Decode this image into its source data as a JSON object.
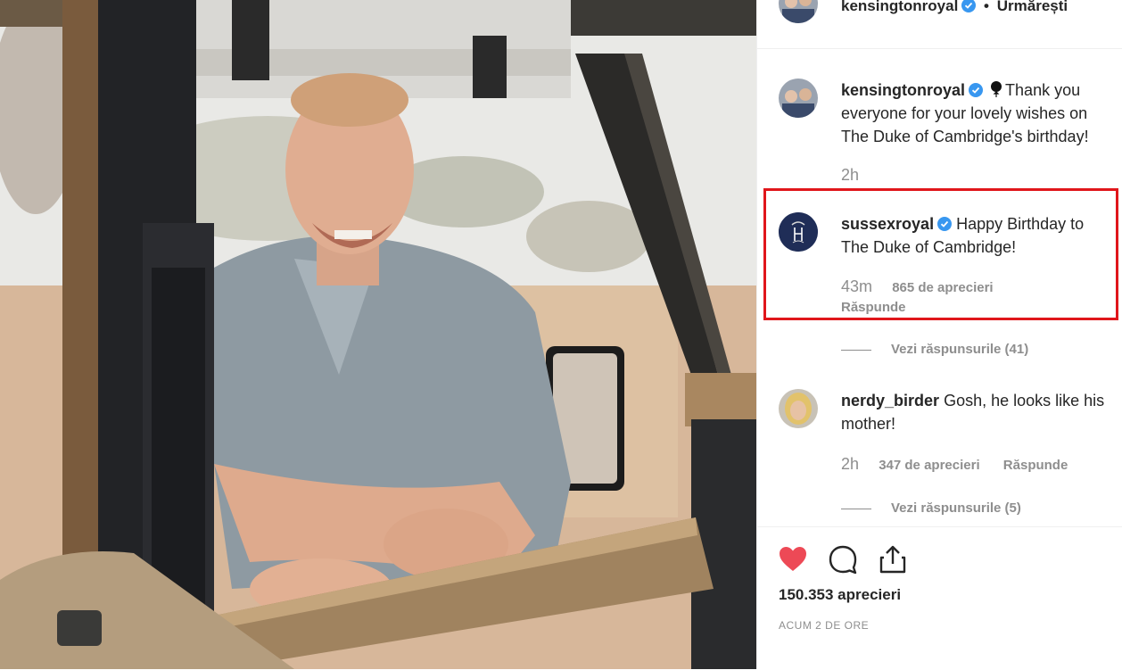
{
  "header": {
    "username": "kensingtonroyal",
    "separator": "•",
    "follow_state": "Urmărești"
  },
  "comments": [
    {
      "username": "kensingtonroyal",
      "text": "Thank you everyone for your lovely wishes on The Duke of Cambridge's birthday!",
      "time": "2h",
      "verified": true
    },
    {
      "username": "sussexroyal",
      "text": "Happy Birthday to The Duke of Cambridge!",
      "time": "43m",
      "likes": "865 de aprecieri",
      "reply_label": "Răspunde",
      "verified": true,
      "highlighted": true,
      "view_replies": "Vezi răspunsurile (41)"
    },
    {
      "username": "nerdy_birder",
      "text": "Gosh, he looks like his mother!",
      "time": "2h",
      "likes": "347 de aprecieri",
      "reply_label": "Răspunde",
      "verified": false,
      "view_replies": "Vezi răspunsurile (5)"
    }
  ],
  "post": {
    "like_count": "150.353 aprecieri",
    "posted_ago": "ACUM 2 DE ORE"
  },
  "colors": {
    "verified_blue": "#3897f0",
    "heart_red": "#ed4956",
    "highlight_red": "#e0161b",
    "muted_text": "#8e8e8e"
  },
  "icons": [
    "verified-badge-icon",
    "balloon-icon",
    "heart-icon",
    "comment-icon",
    "share-icon"
  ]
}
